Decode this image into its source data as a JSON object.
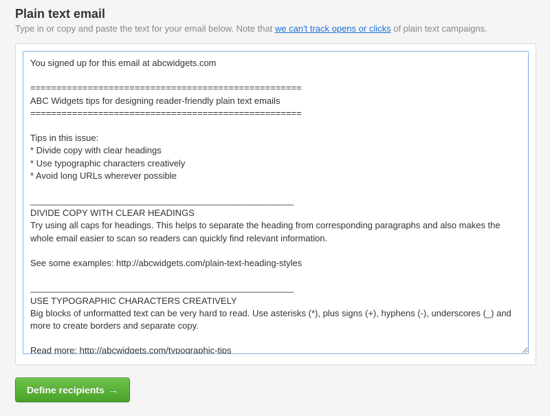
{
  "header": {
    "title": "Plain text email",
    "subtitle_before": "Type in or copy and paste the text for your email below. Note that ",
    "subtitle_link": "we can't track opens or clicks",
    "subtitle_after": " of plain text campaigns."
  },
  "editor": {
    "content": "You signed up for this email at abcwidgets.com\n\n====================================================\nABC Widgets tips for designing reader-friendly plain text emails\n====================================================\n\nTips in this issue:\n* Divide copy with clear headings\n* Use typographic characters creatively\n* Avoid long URLs wherever possible\n\n_____________________________________________________\nDIVIDE COPY WITH CLEAR HEADINGS\nTry using all caps for headings. This helps to separate the heading from corresponding paragraphs and also makes the whole email easier to scan so readers can quickly find relevant information.\n\nSee some examples: http://abcwidgets.com/plain-text-heading-styles\n\n_____________________________________________________\nUSE TYPOGRAPHIC CHARACTERS CREATIVELY\nBig blocks of unformatted text can be very hard to read. Use asterisks (*), plus signs (+), hyphens (-), underscores (_) and more to create borders and separate copy.\n\nRead more: http://abcwidgets.com/typographic-tips"
  },
  "button": {
    "label": "Define recipients",
    "arrow": "→"
  }
}
